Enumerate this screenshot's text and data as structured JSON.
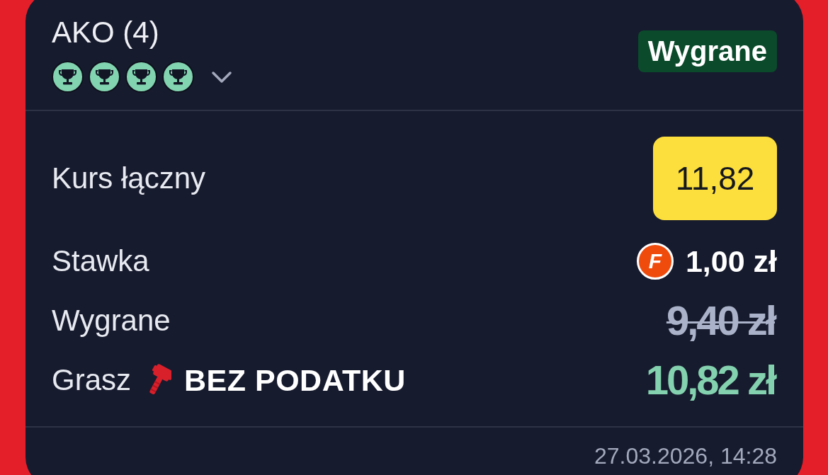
{
  "bet": {
    "title": "AKO (4)",
    "legs": [
      {
        "won": true
      },
      {
        "won": true
      },
      {
        "won": true
      },
      {
        "won": true
      }
    ],
    "expanded": false,
    "status": "Wygrane"
  },
  "summary": [
    {
      "kind": "odds",
      "label": "Kurs łączny",
      "value": "11,82",
      "struck": false
    },
    {
      "kind": "stake",
      "label": "Stawka",
      "badge": "F",
      "value": "1,00 zł",
      "struck": false
    },
    {
      "kind": "winnings",
      "label": "Wygrane",
      "value": "9,40 zł",
      "struck": true
    },
    {
      "kind": "bonus",
      "label": "Grasz",
      "highlight": "BEZ PODATKU",
      "value": "10,82 zł",
      "struck": false
    }
  ],
  "placed_at": "27.03.2026, 14:28"
}
